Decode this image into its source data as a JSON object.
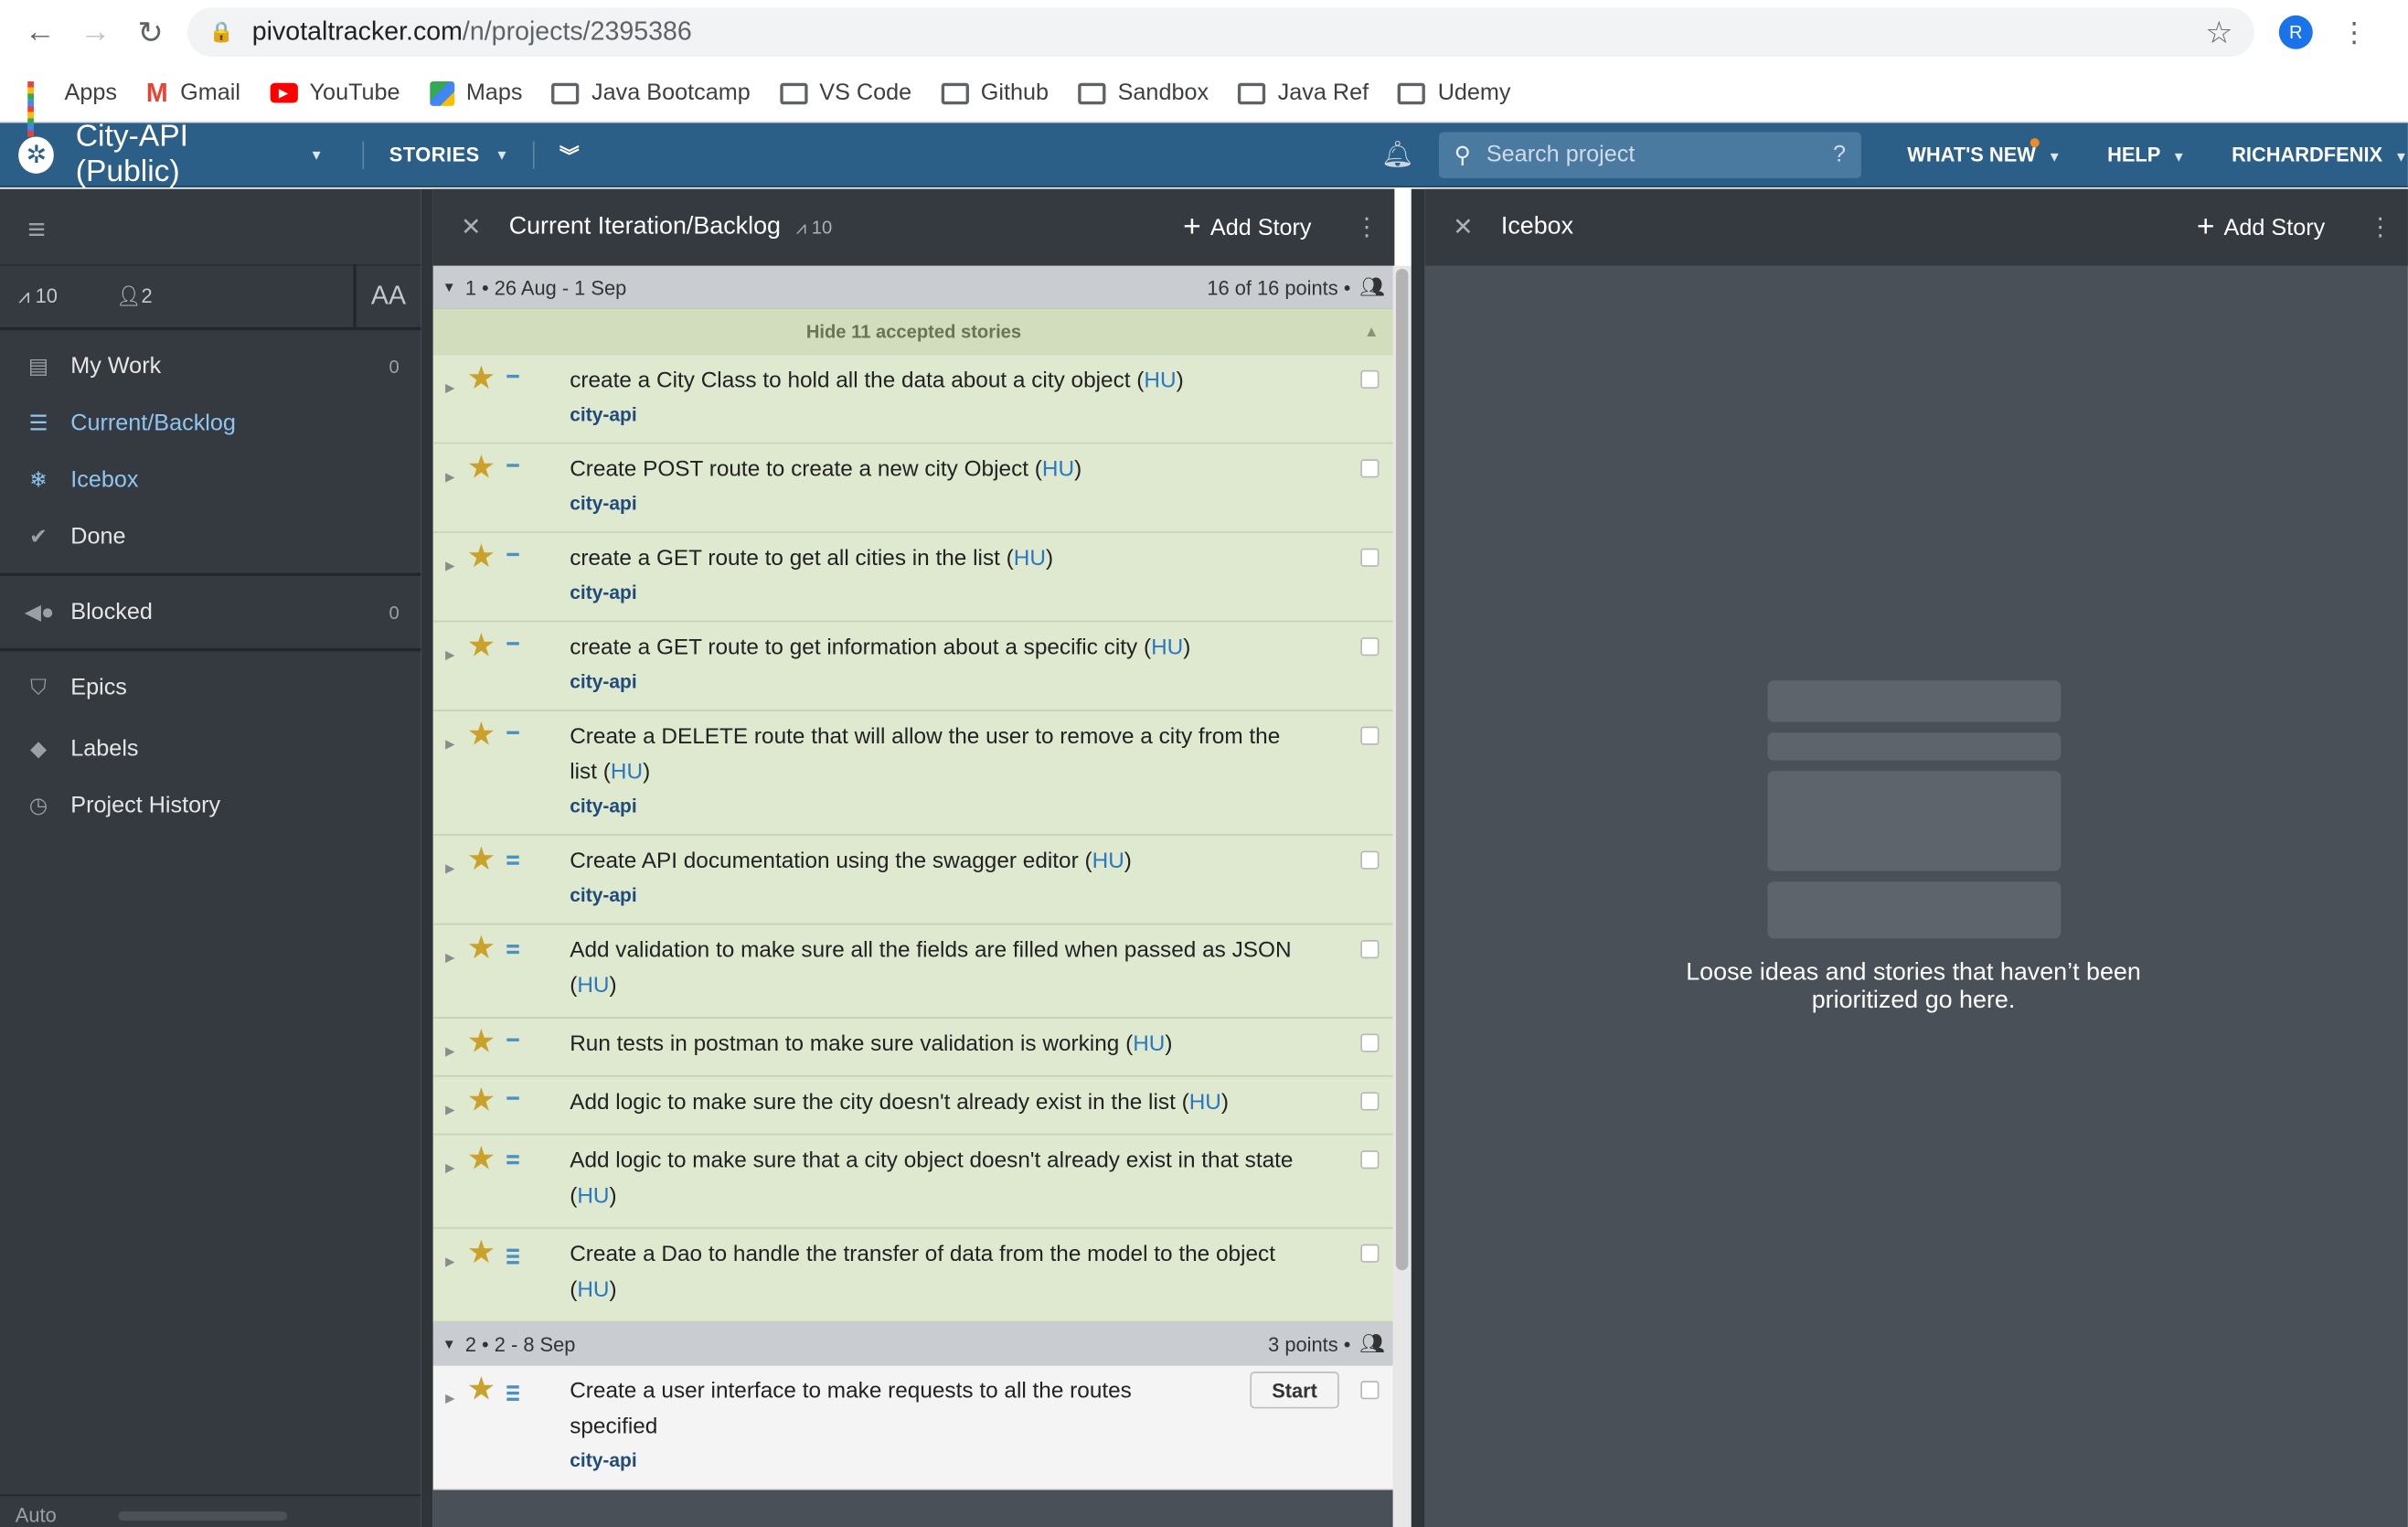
{
  "browser": {
    "url_domain": "pivotaltracker.com",
    "url_path": "/n/projects/2395386",
    "profile_initial": "R",
    "bookmarks": [
      {
        "label": "Apps",
        "icon": "apps-grid-icon"
      },
      {
        "label": "Gmail",
        "icon": "gmail-icon"
      },
      {
        "label": "YouTube",
        "icon": "youtube-icon"
      },
      {
        "label": "Maps",
        "icon": "maps-icon"
      },
      {
        "label": "Java Bootcamp",
        "icon": "folder-icon"
      },
      {
        "label": "VS Code",
        "icon": "folder-icon"
      },
      {
        "label": "Github",
        "icon": "folder-icon"
      },
      {
        "label": "Sandbox",
        "icon": "folder-icon"
      },
      {
        "label": "Java Ref",
        "icon": "folder-icon"
      },
      {
        "label": "Udemy",
        "icon": "folder-icon"
      }
    ]
  },
  "header": {
    "project_name": "City-API (Public)",
    "stories_label": "STORIES",
    "search_placeholder": "Search project",
    "search_help": "?",
    "whats_new": "WHAT'S NEW",
    "help": "HELP",
    "user": "RICHARDFENIX",
    "colors": {
      "bar": "#2c5f87",
      "notification_dot": "#f08a24"
    }
  },
  "sidebar": {
    "velocity": "10",
    "members": "2",
    "font_toggle": "AA",
    "items": [
      {
        "label": "My Work",
        "count": "0",
        "icon": "my-work-icon"
      },
      {
        "label": "Current/Backlog",
        "icon": "list-icon",
        "active": true
      },
      {
        "label": "Icebox",
        "icon": "snowflake-icon"
      },
      {
        "label": "Done",
        "icon": "check-icon"
      },
      {
        "label": "Blocked",
        "count": "0",
        "icon": "blocked-icon"
      },
      {
        "label": "Epics",
        "icon": "epic-icon"
      },
      {
        "label": "Labels",
        "icon": "tag-icon"
      },
      {
        "label": "Project History",
        "icon": "clock-icon"
      }
    ],
    "footer": "Auto"
  },
  "backlog": {
    "title": "Current Iteration/Backlog",
    "velocity": "10",
    "add_story": "Add Story",
    "iteration1": {
      "label": "1 • 26 Aug - 1 Sep",
      "points": "16 of 16 points •",
      "hide_label": "Hide 11 accepted stories"
    },
    "stories": [
      {
        "title": "create a City Class to hold all the data about a city object (",
        "owner": "HU",
        "label": "city-api",
        "est": 1
      },
      {
        "title": "Create POST route to create a new city Object (",
        "owner": "HU",
        "label": "city-api",
        "est": 1
      },
      {
        "title": "create a GET route to get all cities in the list (",
        "owner": "HU",
        "label": "city-api",
        "est": 1
      },
      {
        "title": "create a GET route to get information about a specific city (",
        "owner": "HU",
        "label": "city-api",
        "est": 1
      },
      {
        "title": "Create a DELETE route that will allow the user to remove a city from the list (",
        "owner": "HU",
        "label": "city-api",
        "est": 1
      },
      {
        "title": "Create API documentation using the swagger editor (",
        "owner": "HU",
        "label": "city-api",
        "est": 2
      },
      {
        "title": "Add validation to make sure all the fields are filled when passed as JSON (",
        "owner": "HU",
        "label": "",
        "est": 2
      },
      {
        "title": "Run tests in postman to make sure validation is working  (",
        "owner": "HU",
        "label": "",
        "est": 1
      },
      {
        "title": "Add logic to make sure the city doesn't already exist in the list (",
        "owner": "HU",
        "label": "",
        "est": 1
      },
      {
        "title": "Add logic to make sure that a city object doesn't already exist in that state (",
        "owner": "HU",
        "label": "",
        "est": 2
      },
      {
        "title": "Create a Dao to handle the transfer of data from the model to the object (",
        "owner": "HU",
        "label": "",
        "est": 3
      }
    ],
    "iteration2": {
      "label": "2 • 2 - 8 Sep",
      "points": "3 points •"
    },
    "unstarted": {
      "title": "Create a user interface to make requests to all the routes specified",
      "label": "city-api",
      "start": "Start",
      "est": 3
    }
  },
  "icebox": {
    "title": "Icebox",
    "add_story": "Add Story",
    "empty_message": "Loose ideas and stories that haven’t been prioritized go here."
  }
}
